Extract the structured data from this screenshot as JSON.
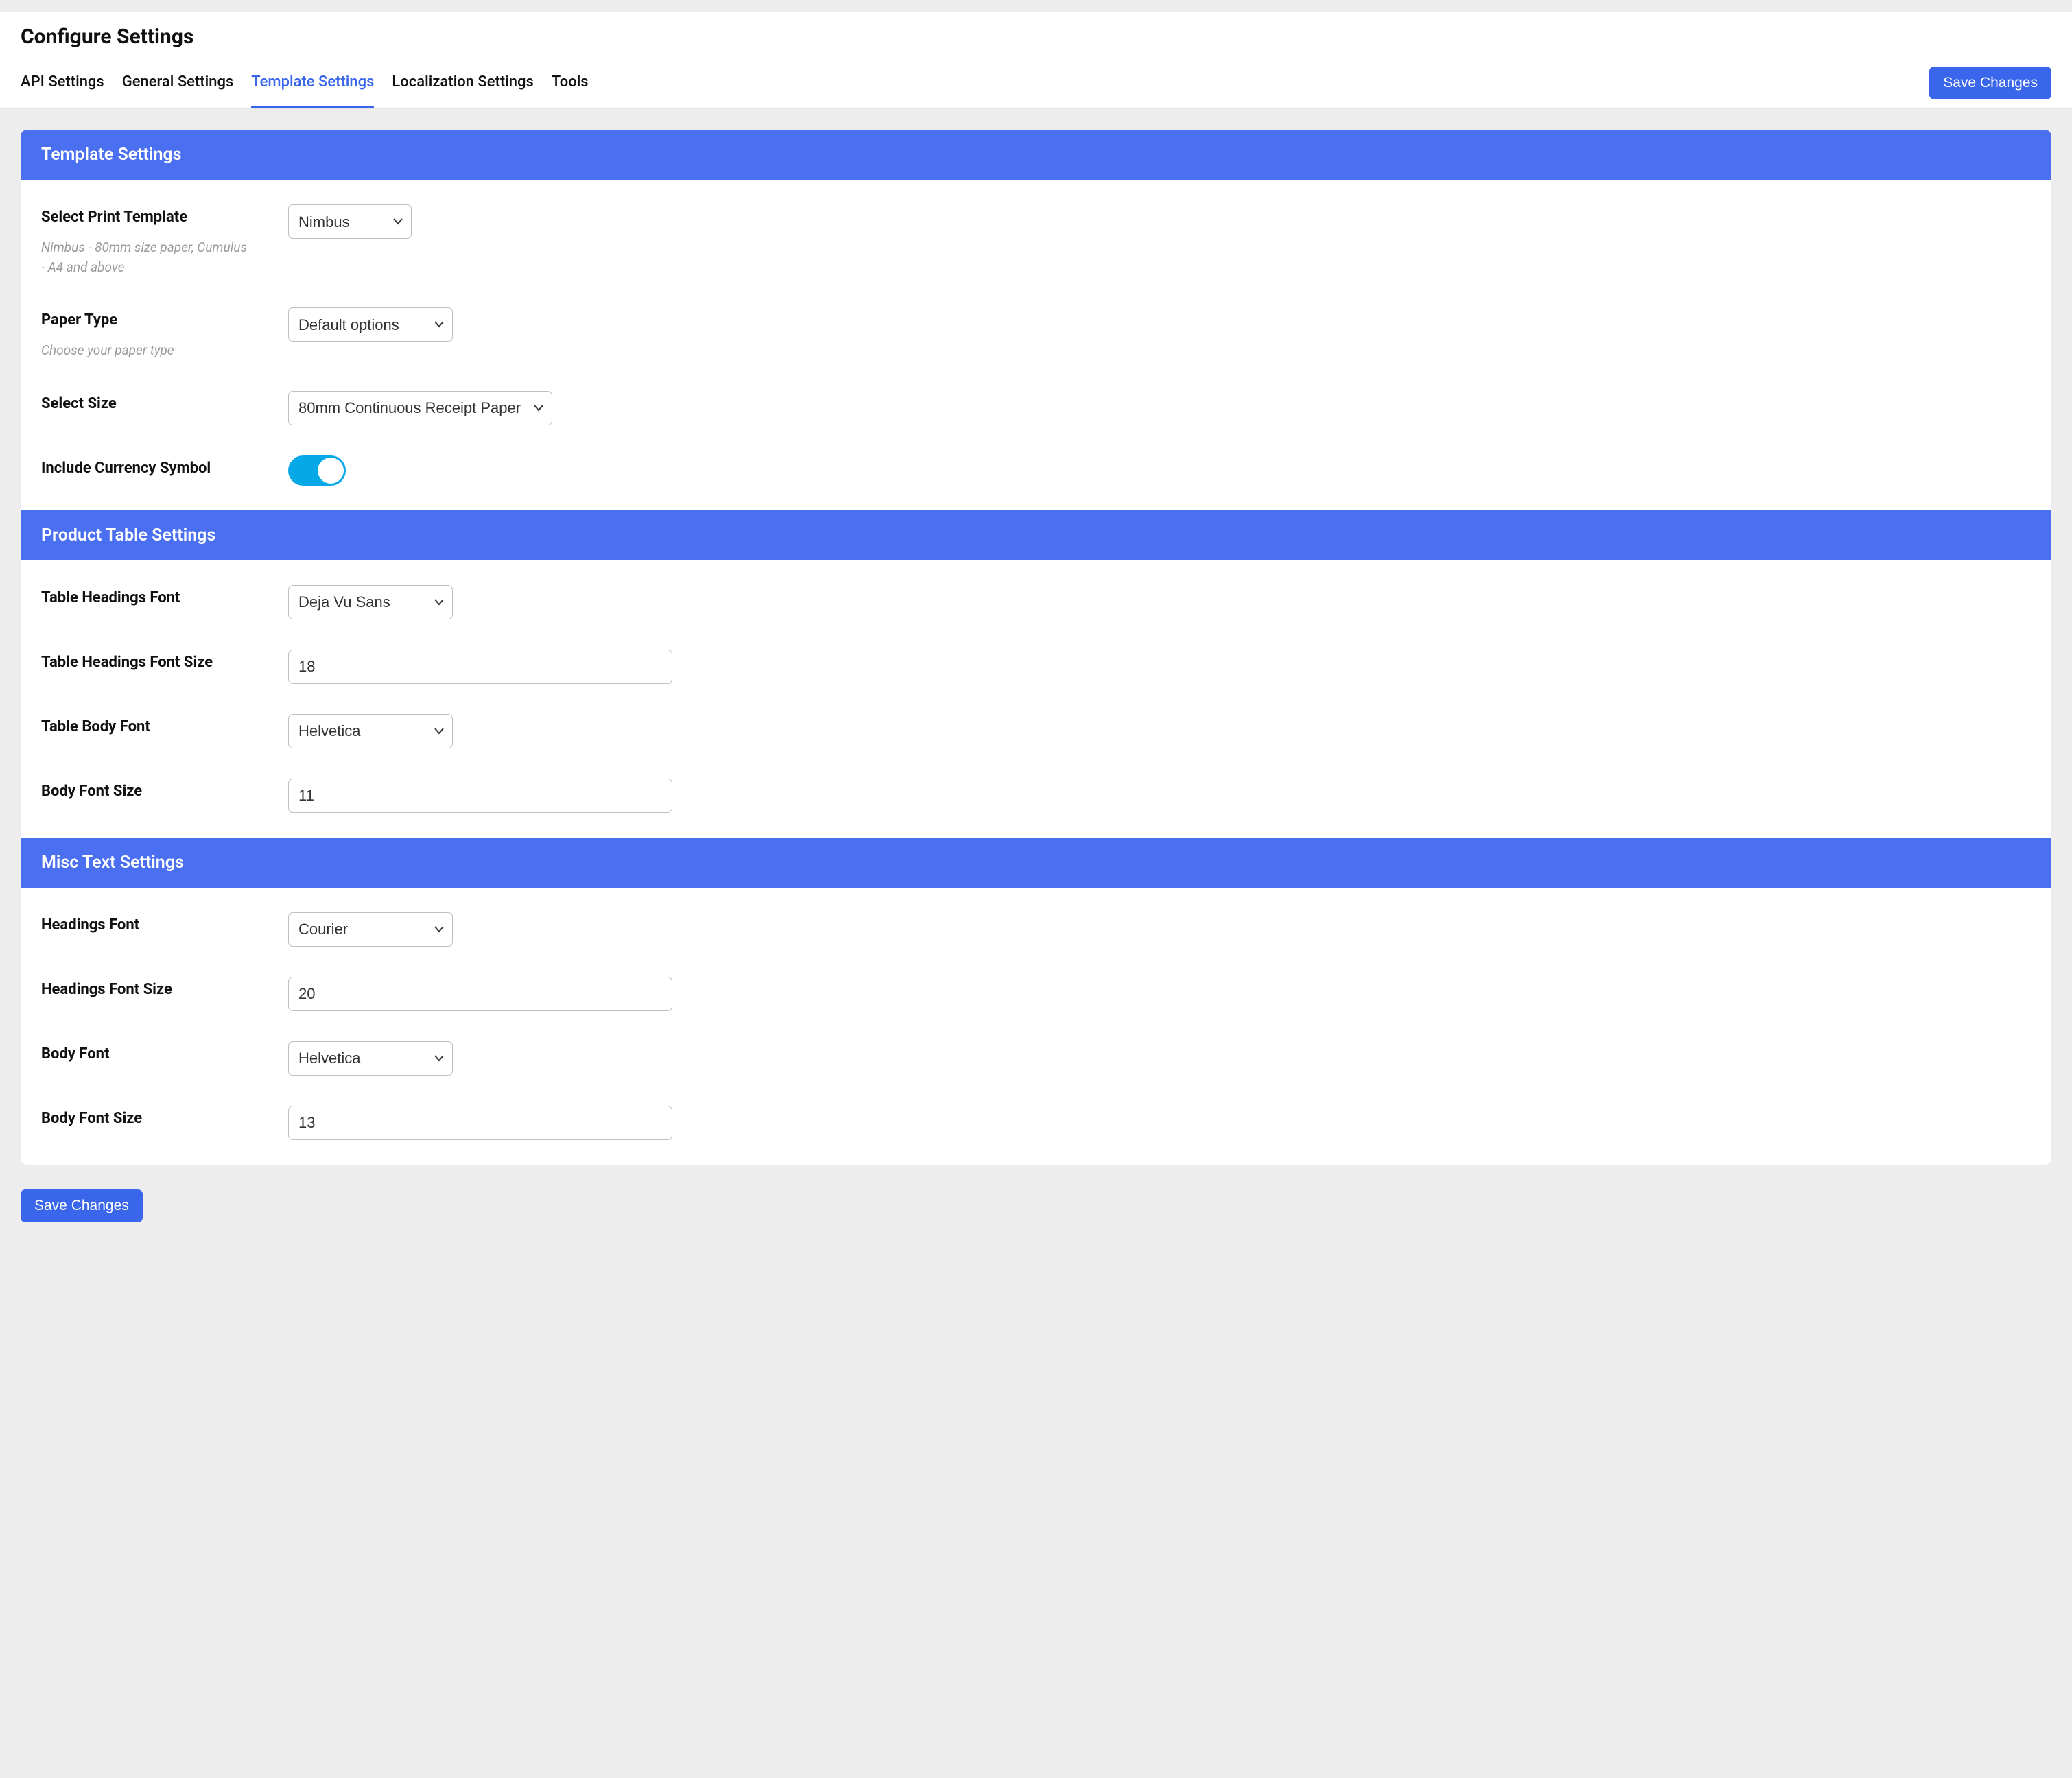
{
  "page": {
    "title": "Configure Settings"
  },
  "tabs": {
    "items": [
      "API Settings",
      "General Settings",
      "Template Settings",
      "Localization Settings",
      "Tools"
    ],
    "active_index": 2
  },
  "buttons": {
    "save_top": "Save Changes",
    "save_bottom": "Save Changes"
  },
  "sections": {
    "template": {
      "title": "Template Settings",
      "fields": {
        "print_template": {
          "label": "Select Print Template",
          "hint": "Nimbus - 80mm size paper, Cumulus - A4 and above",
          "value": "Nimbus"
        },
        "paper_type": {
          "label": "Paper Type",
          "hint": "Choose your paper type",
          "value": "Default options"
        },
        "select_size": {
          "label": "Select Size",
          "value": "80mm Continuous Receipt Paper"
        },
        "include_currency": {
          "label": "Include Currency Symbol",
          "value": true
        }
      }
    },
    "product_table": {
      "title": "Product Table Settings",
      "fields": {
        "headings_font": {
          "label": "Table Headings Font",
          "value": "Deja Vu Sans"
        },
        "headings_font_size": {
          "label": "Table Headings Font Size",
          "value": "18"
        },
        "body_font": {
          "label": "Table Body Font",
          "value": "Helvetica"
        },
        "body_font_size": {
          "label": "Body Font Size",
          "value": "11"
        }
      }
    },
    "misc_text": {
      "title": "Misc Text Settings",
      "fields": {
        "headings_font": {
          "label": "Headings Font",
          "value": "Courier"
        },
        "headings_font_size": {
          "label": "Headings Font Size",
          "value": "20"
        },
        "body_font": {
          "label": "Body Font",
          "value": "Helvetica"
        },
        "body_font_size": {
          "label": "Body Font Size",
          "value": "13"
        }
      }
    }
  }
}
